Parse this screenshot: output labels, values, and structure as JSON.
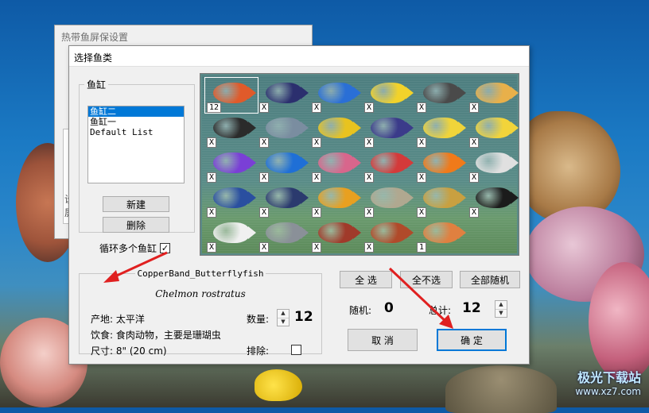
{
  "background_window": {
    "title": "热带鱼屏保设置",
    "fragment_1": "设",
    "fragment_2": "屏"
  },
  "dialog": {
    "title": "选择鱼类"
  },
  "tank_group": {
    "legend": "鱼缸",
    "tanks": [
      "鱼缸二",
      "鱼缸一",
      "Default List"
    ],
    "selected_index": 0,
    "new_button": "新建",
    "delete_button": "删除",
    "loop_label": "循环多个鱼缸",
    "loop_checked": "✓"
  },
  "fish_grid": {
    "rows": [
      [
        {
          "count": "12",
          "color": "#e05a2a"
        },
        {
          "count": "X",
          "color": "#2b2f6e"
        },
        {
          "count": "X",
          "color": "#2a6fd6"
        },
        {
          "count": "X",
          "color": "#f2d22a"
        },
        {
          "count": "X",
          "color": "#4a4a4a"
        },
        {
          "count": "X",
          "color": "#e8b04a"
        }
      ],
      [
        {
          "count": "X",
          "color": "#2b2b2b"
        },
        {
          "count": "X",
          "color": "#7a8da0"
        },
        {
          "count": "X",
          "color": "#e8c31f"
        },
        {
          "count": "X",
          "color": "#3b3b8a"
        },
        {
          "count": "X",
          "color": "#f0d43a"
        },
        {
          "count": "X",
          "color": "#f2d43a"
        }
      ],
      [
        {
          "count": "X",
          "color": "#7a3fd6"
        },
        {
          "count": "X",
          "color": "#1f6fd6"
        },
        {
          "count": "X",
          "color": "#d8668c"
        },
        {
          "count": "X",
          "color": "#d43a3a"
        },
        {
          "count": "X",
          "color": "#f07a1a"
        },
        {
          "count": "X",
          "color": "#e0e0e0"
        }
      ],
      [
        {
          "count": "X",
          "color": "#2a4fa0"
        },
        {
          "count": "X",
          "color": "#2b3a6e"
        },
        {
          "count": "X",
          "color": "#e8a020"
        },
        {
          "count": "X",
          "color": "#b0a890"
        },
        {
          "count": "X",
          "color": "#c9a040"
        },
        {
          "count": "X",
          "color": "#1b1b1b"
        }
      ],
      [
        {
          "count": "X",
          "color": "#f0f0f0"
        },
        {
          "count": "X",
          "color": "#8a9098"
        },
        {
          "count": "X",
          "color": "#a03a2a"
        },
        {
          "count": "X",
          "color": "#b04a2a"
        },
        {
          "count": "1",
          "color": "#e08040"
        }
      ]
    ]
  },
  "selection": {
    "select_all": "全 选",
    "select_none": "全不选",
    "all_random": "全部随机"
  },
  "fish_info": {
    "name": "CopperBand_Butterflyfish",
    "latin": "Chelmon rostratus",
    "origin": "产地: 太平洋",
    "diet": "饮食: 食肉动物，主要是珊瑚虫",
    "size": "尺寸: 8\" (20 cm)",
    "quantity_label": "数量:",
    "quantity_value": "12",
    "exclude_label": "排除:"
  },
  "random": {
    "label": "随机:",
    "value": "0"
  },
  "total": {
    "label": "总计:",
    "value": "12"
  },
  "buttons": {
    "cancel": "取 消",
    "ok": "确 定"
  },
  "watermark": {
    "line1": "极光下载站",
    "line2": "www.xz7.com"
  },
  "colors": {
    "arrow": "#e02020",
    "selection": "#0078d7"
  }
}
